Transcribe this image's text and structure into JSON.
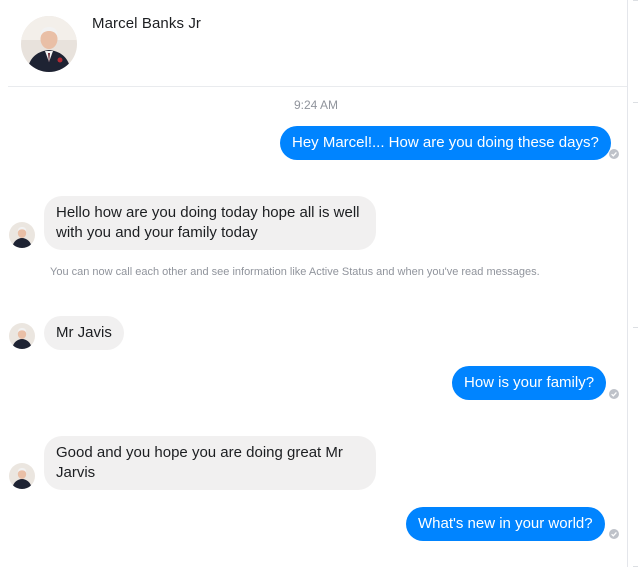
{
  "contact": {
    "name": "Marcel Banks Jr"
  },
  "thread": {
    "timestamp": "9:24 AM",
    "messages": [
      {
        "from": "me",
        "text": "Hey Marcel!... How are you doing these days?"
      },
      {
        "from": "contact",
        "text": "Hello how are you doing today hope all is well with you and your family today"
      },
      {
        "from": "contact",
        "text": "Mr Javis"
      },
      {
        "from": "me",
        "text": "How is your family?"
      },
      {
        "from": "contact",
        "text": "Good and you hope you are doing great Mr Jarvis"
      },
      {
        "from": "me",
        "text": "What's new in your world?"
      }
    ],
    "info_note": "You can now call each other and see information like Active Status and when you've read messages."
  },
  "colors": {
    "outgoing_bubble": "#0084ff",
    "incoming_bubble": "#f1f0f0",
    "seen_indicator": "#bec2c9"
  },
  "icons": {
    "seen": "check-circle-icon",
    "avatar": "profile-photo"
  }
}
